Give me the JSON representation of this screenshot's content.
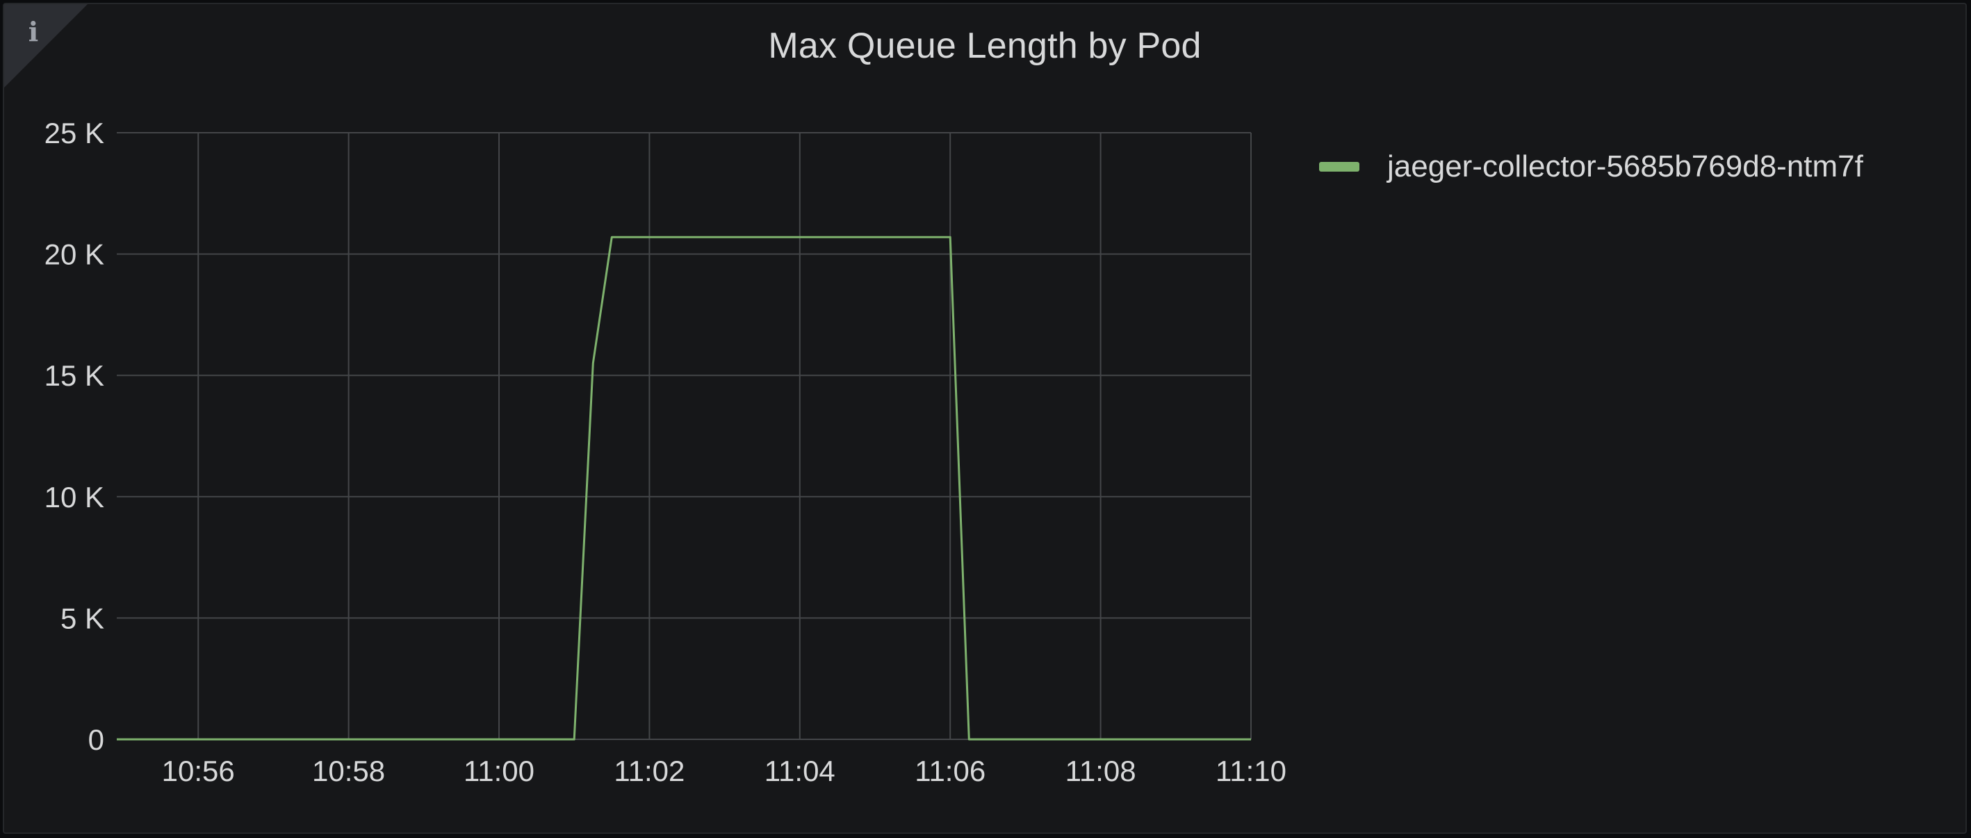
{
  "panel": {
    "title": "Max Queue Length by Pod",
    "info_icon": "info-icon"
  },
  "colors": {
    "background": "#161719",
    "grid": "#444649",
    "text": "#d8d9da",
    "series": "#7eb26d"
  },
  "chart_data": {
    "type": "line",
    "title": "Max Queue Length by Pod",
    "xlabel": "",
    "ylabel": "",
    "x_ticks": [
      "10:56",
      "10:58",
      "11:00",
      "11:02",
      "11:04",
      "11:06",
      "11:08",
      "11:10"
    ],
    "y_ticks": [
      "0",
      "5 K",
      "10 K",
      "15 K",
      "20 K",
      "25 K"
    ],
    "ylim": [
      0,
      25000
    ],
    "xlim": [
      "10:54:55",
      "11:10:00"
    ],
    "grid": true,
    "legend_position": "right",
    "series": [
      {
        "name": "jaeger-collector-5685b769d8-ntm7f",
        "color": "#7eb26d",
        "points": [
          {
            "x": "10:54:55",
            "y": 0
          },
          {
            "x": "11:01:00",
            "y": 0
          },
          {
            "x": "11:01:15",
            "y": 15500
          },
          {
            "x": "11:01:30",
            "y": 20700
          },
          {
            "x": "11:06:00",
            "y": 20700
          },
          {
            "x": "11:06:15",
            "y": 0
          },
          {
            "x": "11:10:00",
            "y": 0
          }
        ]
      }
    ]
  }
}
